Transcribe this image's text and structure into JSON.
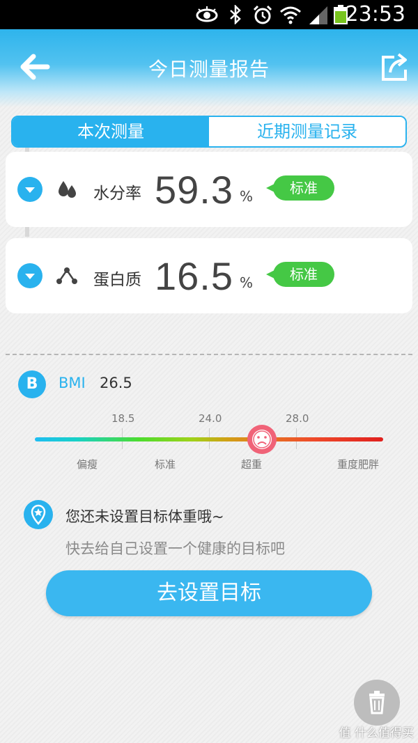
{
  "status_bar": {
    "time": "23:53"
  },
  "header": {
    "title": "今日测量报告"
  },
  "tabs": [
    {
      "label": "本次测量",
      "active": true
    },
    {
      "label": "近期测量记录",
      "active": false
    }
  ],
  "metrics": [
    {
      "label": "水分率",
      "value": "59.3",
      "unit": "%",
      "status": "标准",
      "icon": "water-drop-icon"
    },
    {
      "label": "蛋白质",
      "value": "16.5",
      "unit": "%",
      "status": "标准",
      "icon": "molecule-icon"
    }
  ],
  "bmi": {
    "badge": "B",
    "label": "BMI",
    "value": "26.5",
    "thresholds": [
      "18.5",
      "24.0",
      "28.0"
    ],
    "categories": [
      "偏瘦",
      "标准",
      "超重",
      "重度肥胖"
    ]
  },
  "goal": {
    "title": "您还未设置目标体重哦~",
    "subtitle": "快去给自己设置一个健康的目标吧",
    "button": "去设置目标"
  },
  "watermark": "值 什么值得买",
  "colors": {
    "accent": "#29b2ee",
    "badge": "#45c845",
    "marker": "#f06378"
  }
}
